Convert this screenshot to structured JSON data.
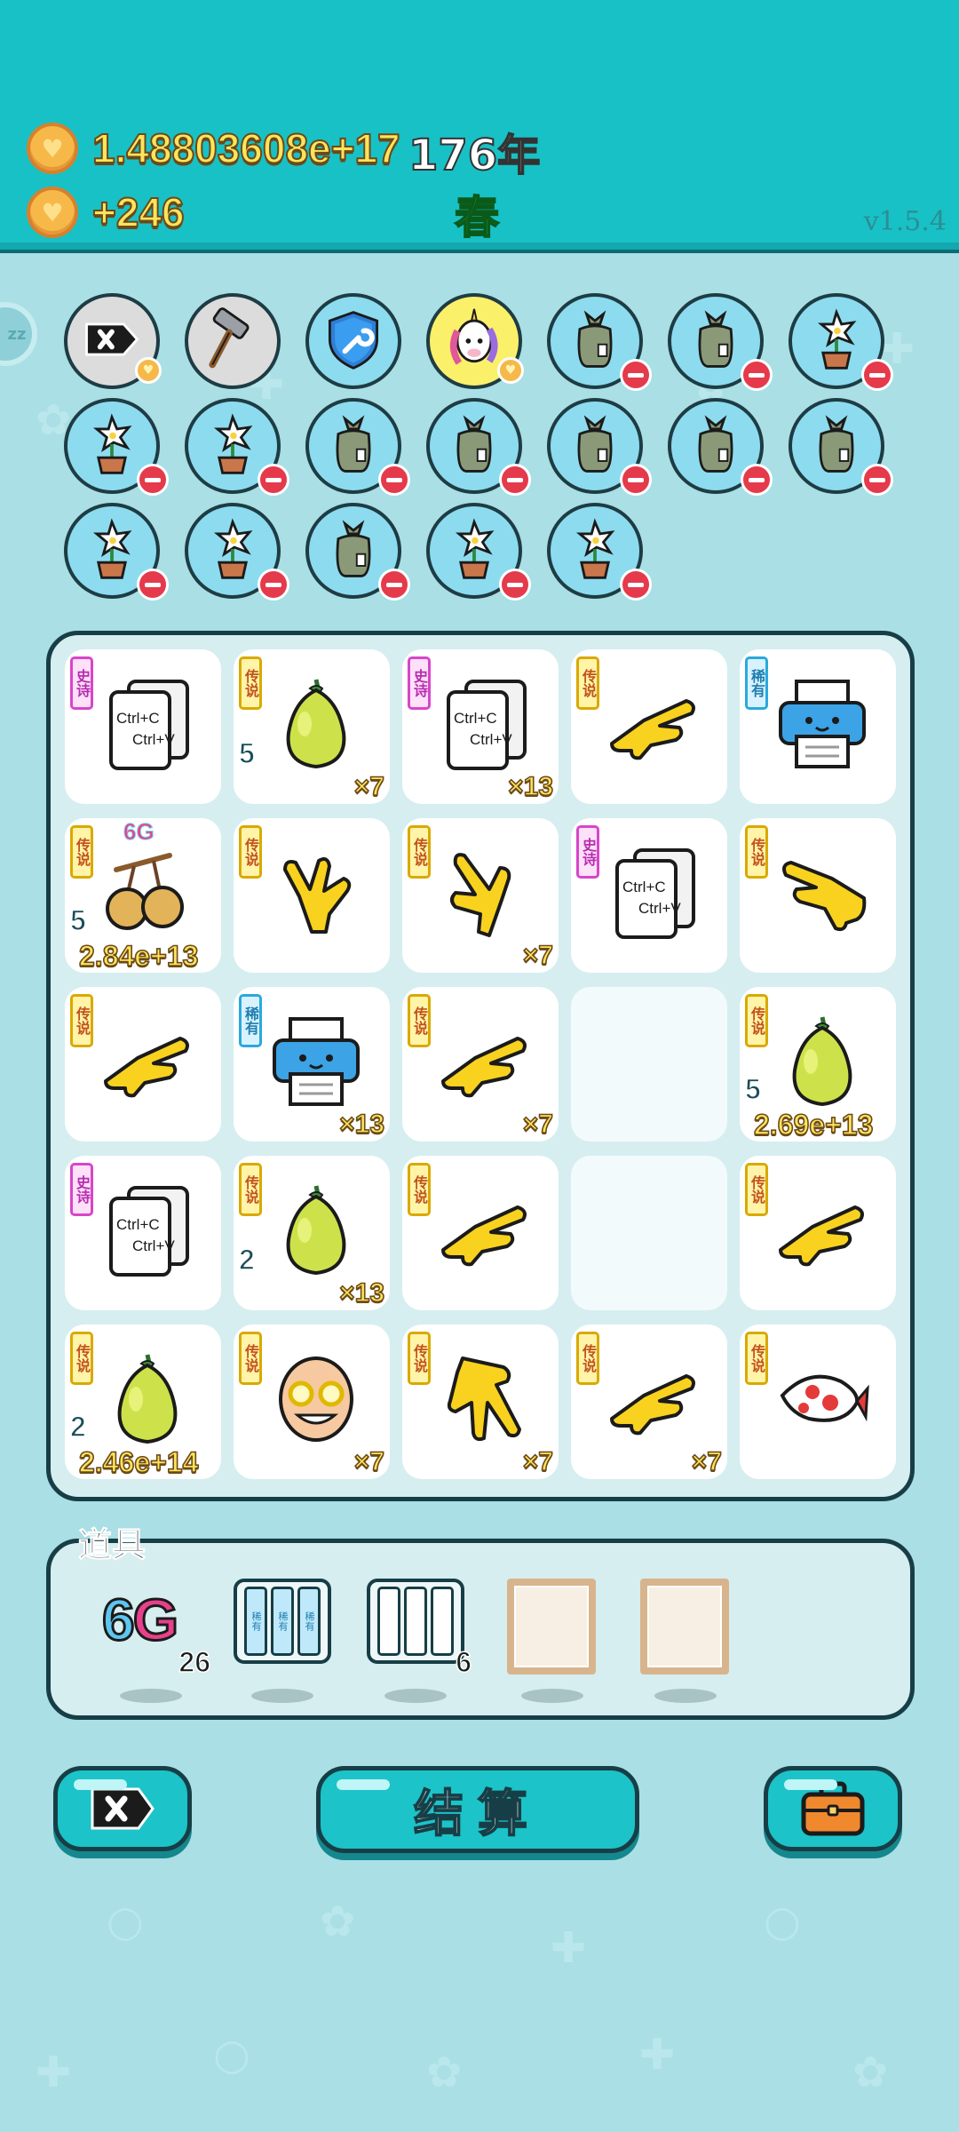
{
  "header": {
    "coins_value": "1.48803608e+17",
    "year_text": "176年",
    "income_value": "+246",
    "season": "春",
    "version": "v1.5.4"
  },
  "icons": {
    "coin": "heart-coin-icon",
    "sleep": "zz-sleep-icon"
  },
  "sleep_label": "zz",
  "relics": [
    {
      "icon": "delete-tag-icon",
      "style": "gray",
      "badge": "heart"
    },
    {
      "icon": "hammer-icon",
      "style": "gray",
      "badge": ""
    },
    {
      "icon": "wrench-shield-icon",
      "style": "blue",
      "badge": ""
    },
    {
      "icon": "unicorn-icon",
      "style": "yellow",
      "badge": "heart"
    },
    {
      "icon": "trash-bag-icon",
      "style": "blue",
      "badge": "minus"
    },
    {
      "icon": "trash-bag-icon",
      "style": "blue",
      "badge": "minus"
    },
    {
      "icon": "flower-pot-icon",
      "style": "blue",
      "badge": "minus"
    },
    {
      "icon": "flower-pot-icon",
      "style": "blue",
      "badge": "minus"
    },
    {
      "icon": "flower-pot-icon",
      "style": "blue",
      "badge": "minus"
    },
    {
      "icon": "trash-bag-icon",
      "style": "blue",
      "badge": "minus"
    },
    {
      "icon": "trash-bag-icon",
      "style": "blue",
      "badge": "minus"
    },
    {
      "icon": "trash-bag-icon",
      "style": "blue",
      "badge": "minus"
    },
    {
      "icon": "trash-bag-icon",
      "style": "blue",
      "badge": "minus"
    },
    {
      "icon": "trash-bag-icon",
      "style": "blue",
      "badge": "minus"
    },
    {
      "icon": "flower-pot-icon",
      "style": "blue",
      "badge": "minus"
    },
    {
      "icon": "flower-pot-icon",
      "style": "blue",
      "badge": "minus"
    },
    {
      "icon": "trash-bag-icon",
      "style": "blue",
      "badge": "minus"
    },
    {
      "icon": "flower-pot-icon",
      "style": "blue",
      "badge": "minus"
    },
    {
      "icon": "flower-pot-icon",
      "style": "blue",
      "badge": "minus"
    }
  ],
  "board": [
    {
      "item": "copy-paste-card",
      "rarity": "史诗",
      "type": "epic",
      "count": "",
      "level": "",
      "value": "",
      "extra": ""
    },
    {
      "item": "pomelo",
      "rarity": "传说",
      "type": "legend",
      "count": "×7",
      "level": "5",
      "value": "",
      "extra": ""
    },
    {
      "item": "copy-paste-card",
      "rarity": "史诗",
      "type": "epic",
      "count": "×13",
      "level": "",
      "value": "",
      "extra": ""
    },
    {
      "item": "pointing-hand-right",
      "rarity": "传说",
      "type": "legend",
      "count": "",
      "level": "",
      "value": "",
      "extra": ""
    },
    {
      "item": "printer",
      "rarity": "稀有",
      "type": "rare",
      "count": "",
      "level": "",
      "value": "",
      "extra": ""
    },
    {
      "item": "cherries",
      "rarity": "传说",
      "type": "legend",
      "count": "",
      "level": "5",
      "value": "2.84e+13",
      "extra": "6G"
    },
    {
      "item": "pointing-hand-up",
      "rarity": "传说",
      "type": "legend",
      "count": "",
      "level": "",
      "value": "",
      "extra": ""
    },
    {
      "item": "pointing-hand-up-left",
      "rarity": "传说",
      "type": "legend",
      "count": "×7",
      "level": "",
      "value": "",
      "extra": ""
    },
    {
      "item": "copy-paste-card",
      "rarity": "史诗",
      "type": "epic",
      "count": "",
      "level": "",
      "value": "",
      "extra": ""
    },
    {
      "item": "pointing-hand-left",
      "rarity": "传说",
      "type": "legend",
      "count": "",
      "level": "",
      "value": "",
      "extra": ""
    },
    {
      "item": "pointing-hand-right",
      "rarity": "传说",
      "type": "legend",
      "count": "",
      "level": "",
      "value": "",
      "extra": ""
    },
    {
      "item": "printer",
      "rarity": "稀有",
      "type": "rare",
      "count": "×13",
      "level": "",
      "value": "",
      "extra": ""
    },
    {
      "item": "pointing-hand-right",
      "rarity": "传说",
      "type": "legend",
      "count": "×7",
      "level": "",
      "value": "",
      "extra": ""
    },
    {
      "item": "",
      "rarity": "",
      "type": "",
      "count": "",
      "level": "",
      "value": "",
      "extra": ""
    },
    {
      "item": "pomelo",
      "rarity": "传说",
      "type": "legend",
      "count": "",
      "level": "5",
      "value": "2.69e+13",
      "extra": ""
    },
    {
      "item": "copy-paste-card",
      "rarity": "史诗",
      "type": "epic",
      "count": "",
      "level": "",
      "value": "",
      "extra": ""
    },
    {
      "item": "pomelo",
      "rarity": "传说",
      "type": "legend",
      "count": "×13",
      "level": "2",
      "value": "",
      "extra": ""
    },
    {
      "item": "pointing-hand-right",
      "rarity": "传说",
      "type": "legend",
      "count": "",
      "level": "",
      "value": "",
      "extra": ""
    },
    {
      "item": "",
      "rarity": "",
      "type": "",
      "count": "",
      "level": "",
      "value": "",
      "extra": ""
    },
    {
      "item": "pointing-hand-right",
      "rarity": "传说",
      "type": "legend",
      "count": "",
      "level": "",
      "value": "",
      "extra": ""
    },
    {
      "item": "pomelo",
      "rarity": "传说",
      "type": "legend",
      "count": "",
      "level": "2",
      "value": "2.46e+14",
      "extra": ""
    },
    {
      "item": "old-man-glasses",
      "rarity": "传说",
      "type": "legend",
      "count": "×7",
      "level": "",
      "value": "",
      "extra": ""
    },
    {
      "item": "pointing-hand-down",
      "rarity": "传说",
      "type": "legend",
      "count": "×7",
      "level": "",
      "value": "",
      "extra": ""
    },
    {
      "item": "pointing-hand-right",
      "rarity": "传说",
      "type": "legend",
      "count": "×7",
      "level": "",
      "value": "",
      "extra": ""
    },
    {
      "item": "koi-fish",
      "rarity": "传说",
      "type": "legend",
      "count": "",
      "level": "",
      "value": "",
      "extra": ""
    }
  ],
  "copy_card_lines": [
    "Ctrl+C",
    "Ctrl+V"
  ],
  "items_panel": {
    "title": "道具",
    "slots": [
      {
        "icon": "6g-icon",
        "label_6": "6",
        "label_g": "G",
        "count": "26"
      },
      {
        "icon": "rare-cards-icon",
        "card_label": "稀有",
        "count": ""
      },
      {
        "icon": "blank-cards-icon",
        "count": "6"
      },
      {
        "icon": "empty-frame-icon",
        "count": ""
      },
      {
        "icon": "empty-frame-icon",
        "count": ""
      }
    ]
  },
  "buttons": {
    "delete_icon": "delete-tag-icon",
    "settle_label": "结算",
    "bag_icon": "briefcase-icon"
  },
  "colors": {
    "header_bg": "#18c1c6",
    "body_bg": "#a7dde3",
    "gold_text": "#ffe45c",
    "season_green": "#1fa83a",
    "legend_tag": "#d9a900",
    "epic_tag": "#d845c9",
    "rare_tag": "#2aa8de"
  }
}
